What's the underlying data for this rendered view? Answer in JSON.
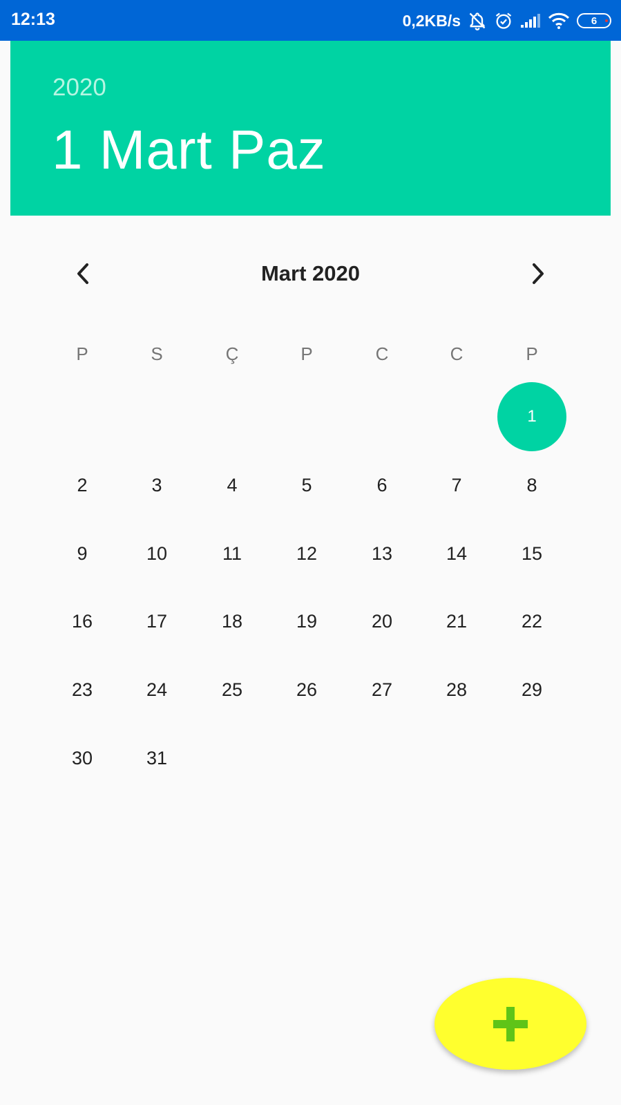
{
  "status_bar": {
    "time": "12:13",
    "network_speed": "0,2KB/s",
    "icons": [
      "mute-icon",
      "alarm-icon",
      "signal-icon",
      "wifi-icon",
      "battery-icon"
    ],
    "battery_level": "6"
  },
  "header": {
    "year": "2020",
    "selected_date": "1 Mart Paz",
    "color": "#00d3a3"
  },
  "calendar": {
    "month_title": "Mart 2020",
    "prev_icon": "chevron-left-icon",
    "next_icon": "chevron-right-icon",
    "weekdays": [
      "P",
      "S",
      "Ç",
      "P",
      "C",
      "C",
      "P"
    ],
    "weeks": [
      [
        "",
        "",
        "",
        "",
        "",
        "",
        "1"
      ],
      [
        "2",
        "3",
        "4",
        "5",
        "6",
        "7",
        "8"
      ],
      [
        "9",
        "10",
        "11",
        "12",
        "13",
        "14",
        "15"
      ],
      [
        "16",
        "17",
        "18",
        "19",
        "20",
        "21",
        "22"
      ],
      [
        "23",
        "24",
        "25",
        "26",
        "27",
        "28",
        "29"
      ],
      [
        "30",
        "31",
        "",
        "",
        "",
        "",
        ""
      ]
    ],
    "selected_day": "1",
    "selection_color": "#00d3a3"
  },
  "fab": {
    "icon": "plus-icon",
    "background": "#ffff2e",
    "icon_color": "#5fc418"
  }
}
